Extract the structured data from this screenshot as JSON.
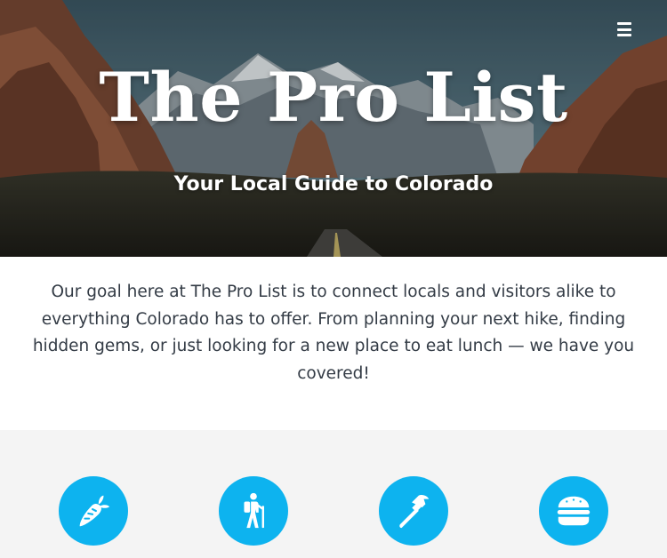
{
  "header": {
    "title": "The Pro List",
    "subtitle": "Your Local Guide to Colorado",
    "menu_icon": "hamburger-menu-icon"
  },
  "intro": {
    "text": "Our goal here at The Pro List is to connect locals and visitors alike to everything Colorado has to offer. From planning your next hike, finding hidden gems, or just looking for a new place to eat lunch — we have you covered!"
  },
  "features": [
    {
      "icon": "carrot-icon"
    },
    {
      "icon": "hiking-icon"
    },
    {
      "icon": "hammer-icon"
    },
    {
      "icon": "hamburger-icon"
    }
  ],
  "colors": {
    "accent": "#0db3ef",
    "text": "#333b45",
    "section_bg": "#f4f4f4"
  }
}
